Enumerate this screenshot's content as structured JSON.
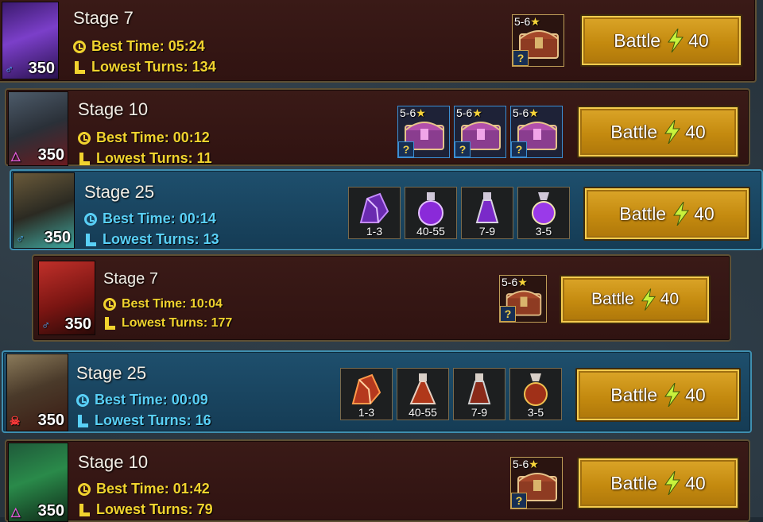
{
  "stages": [
    {
      "title": "Stage 7",
      "best_time": "Best Time: 05:24",
      "lowest_turns": "Lowest Turns: 134",
      "level": "350",
      "affinity": "magic",
      "rewards_type": "chest",
      "rewards": [
        {
          "rank": "5-6",
          "unknown": "?"
        }
      ],
      "battle_label": "Battle",
      "energy_cost": "40"
    },
    {
      "title": "Stage 10",
      "best_time": "Best Time: 00:12",
      "lowest_turns": "Lowest Turns: 11",
      "level": "350",
      "affinity": "spirit",
      "rewards_type": "chest",
      "rewards": [
        {
          "rank": "5-6",
          "unknown": "?"
        },
        {
          "rank": "5-6",
          "unknown": "?"
        },
        {
          "rank": "5-6",
          "unknown": "?"
        }
      ],
      "battle_label": "Battle",
      "energy_cost": "40"
    },
    {
      "title": "Stage 25",
      "best_time": "Best Time: 00:14",
      "lowest_turns": "Lowest Turns: 13",
      "level": "350",
      "affinity": "magic",
      "rewards_type": "items",
      "rewards": [
        {
          "count": "1-3"
        },
        {
          "count": "40-55"
        },
        {
          "count": "7-9"
        },
        {
          "count": "3-5"
        }
      ],
      "battle_label": "Battle",
      "energy_cost": "40"
    },
    {
      "title": "Stage 7",
      "best_time": "Best Time: 10:04",
      "lowest_turns": "Lowest Turns: 177",
      "level": "350",
      "affinity": "magic",
      "rewards_type": "chest",
      "rewards": [
        {
          "rank": "5-6",
          "unknown": "?"
        }
      ],
      "battle_label": "Battle",
      "energy_cost": "40"
    },
    {
      "title": "Stage 25",
      "best_time": "Best Time: 00:09",
      "lowest_turns": "Lowest Turns: 16",
      "level": "350",
      "affinity": "force",
      "rewards_type": "items",
      "rewards": [
        {
          "count": "1-3"
        },
        {
          "count": "40-55"
        },
        {
          "count": "7-9"
        },
        {
          "count": "3-5"
        }
      ],
      "battle_label": "Battle",
      "energy_cost": "40"
    },
    {
      "title": "Stage 10",
      "best_time": "Best Time: 01:42",
      "lowest_turns": "Lowest Turns: 79",
      "level": "350",
      "affinity": "spirit",
      "rewards_type": "chest",
      "rewards": [
        {
          "rank": "5-6",
          "unknown": "?"
        }
      ],
      "battle_label": "Battle",
      "energy_cost": "40"
    }
  ],
  "rank_star": "★",
  "affinity_symbols": {
    "magic": "♂",
    "spirit": "△",
    "force": "☠"
  },
  "colors": {
    "gold_text": "#f1d32e",
    "blue_text": "#59d0f7",
    "battle_gold": "#c48a0f",
    "epic_border": "#3b8fd3"
  }
}
